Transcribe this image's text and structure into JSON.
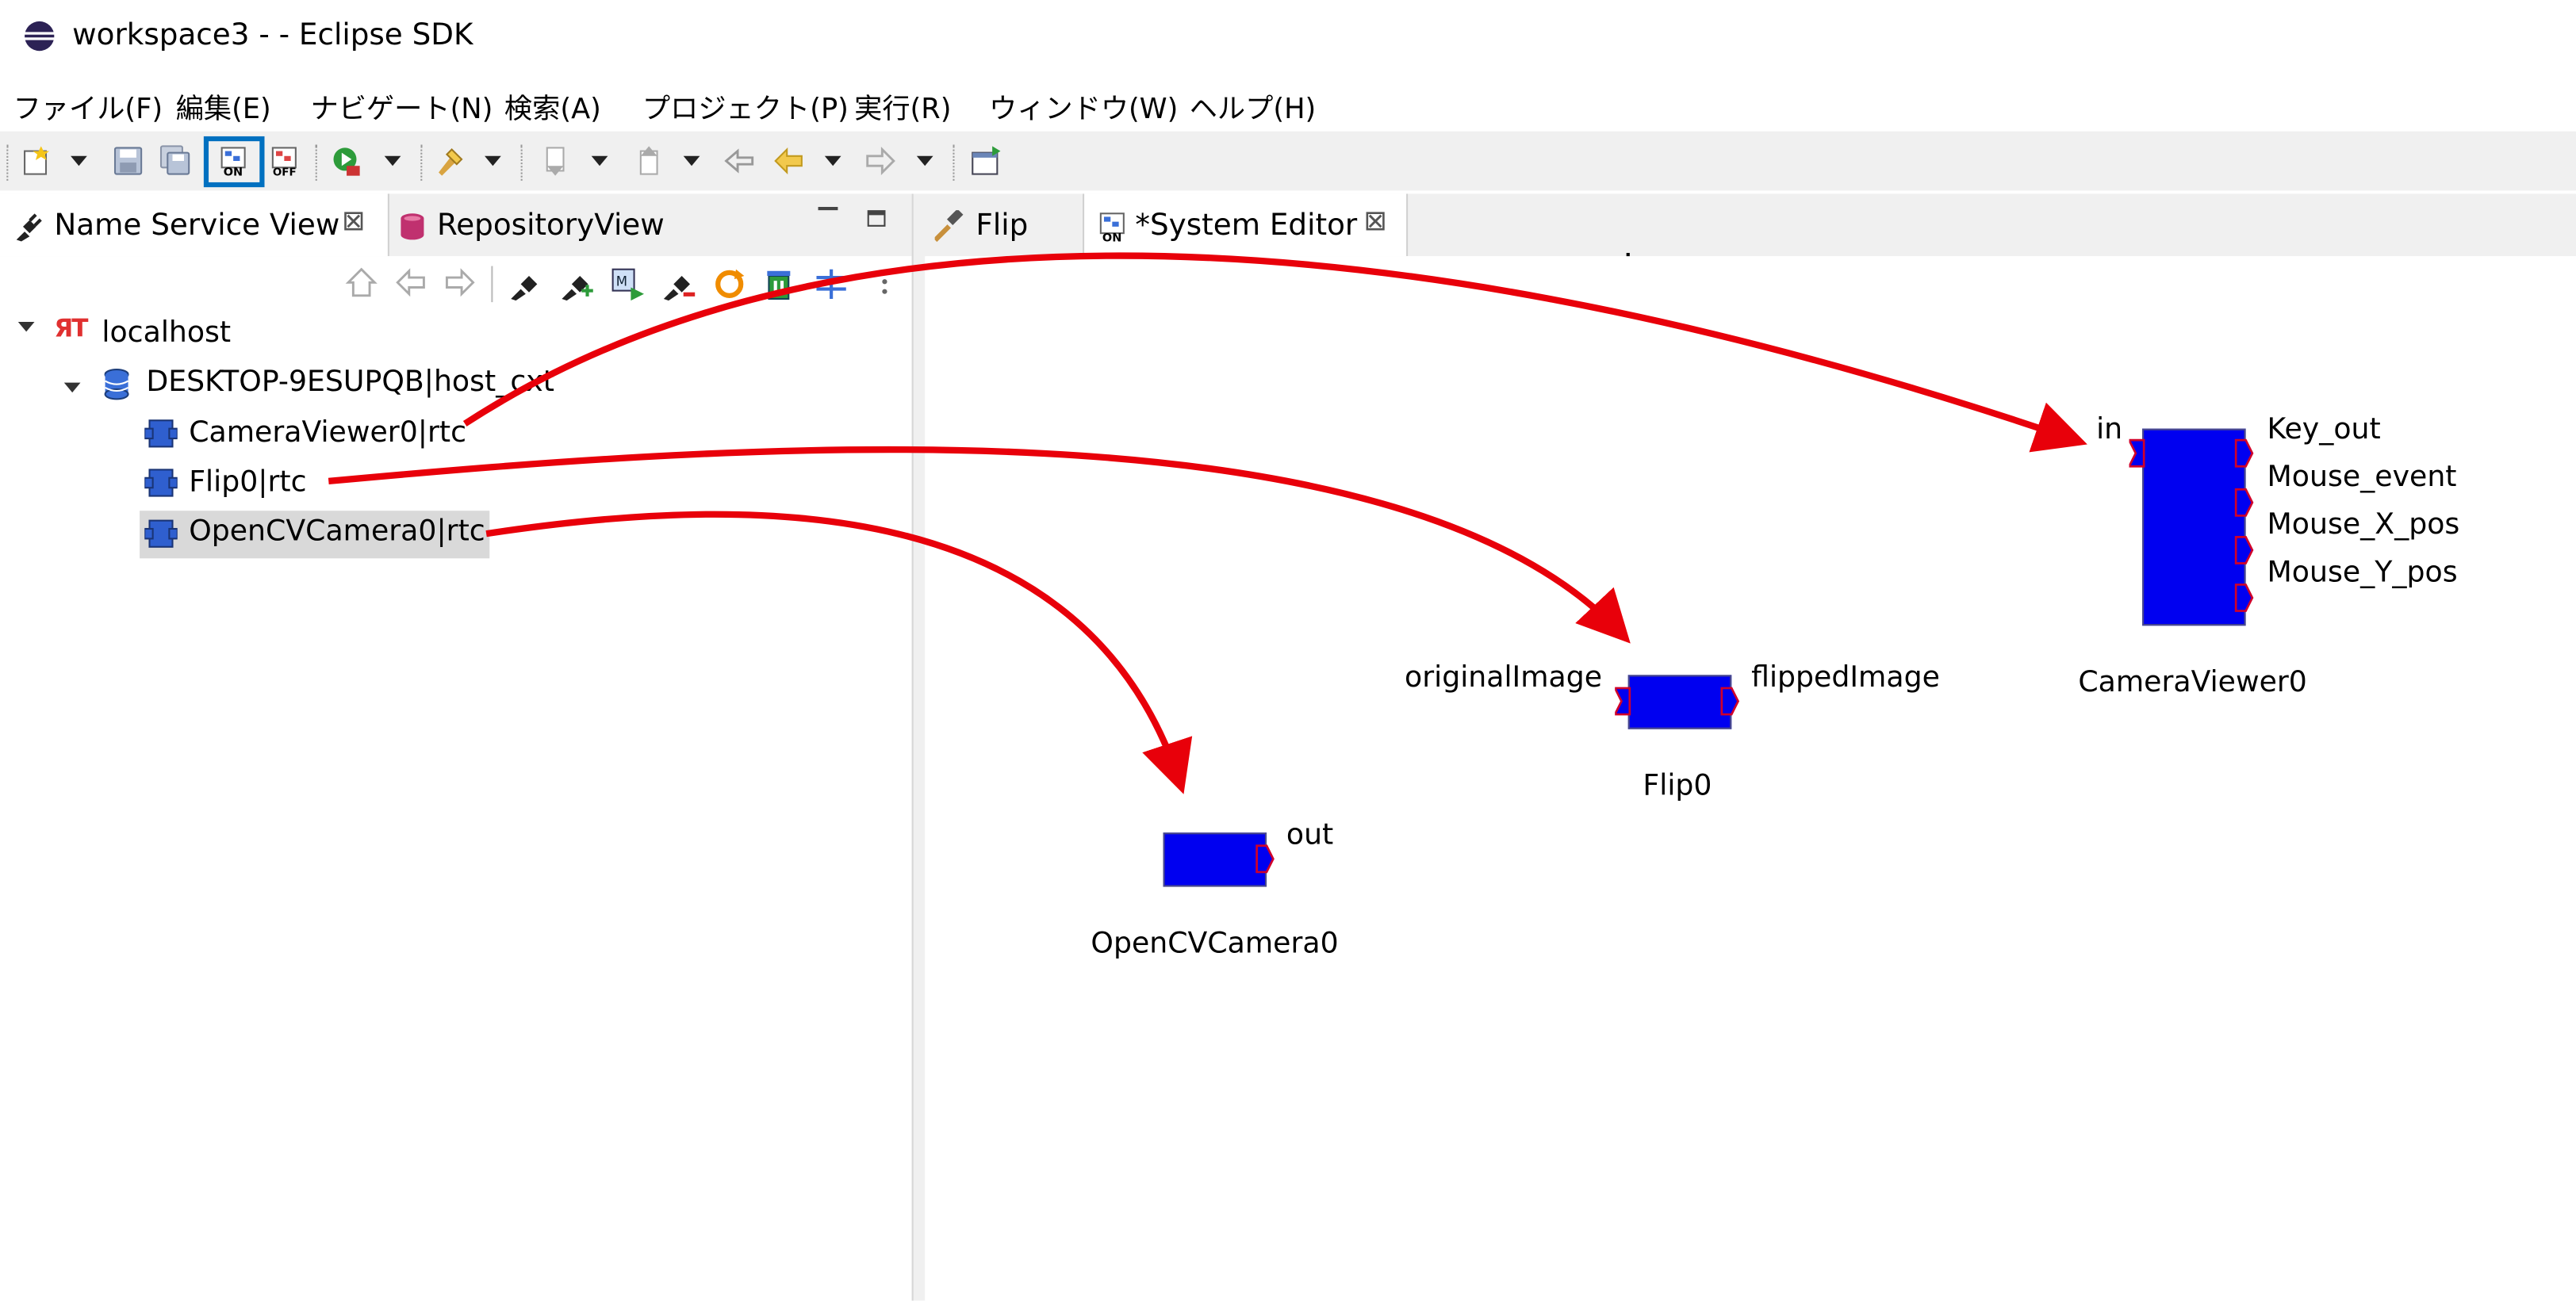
{
  "window": {
    "title": "workspace3 -  - Eclipse SDK"
  },
  "menu": [
    {
      "label": "ファイル(F)"
    },
    {
      "label": "編集(E)"
    },
    {
      "label": "ナビゲート(N)"
    },
    {
      "label": "検索(A)"
    },
    {
      "label": "プロジェクト(P)"
    },
    {
      "label": "実行(R)"
    },
    {
      "label": "ウィンドウ(W)"
    },
    {
      "label": "ヘルプ(H)"
    }
  ],
  "left_tabs": [
    {
      "label": "Name Service View",
      "active": true
    },
    {
      "label": "RepositoryView",
      "active": false
    }
  ],
  "editor_tabs": [
    {
      "label": "Flip",
      "active": false
    },
    {
      "label": "*System Editor",
      "active": true
    }
  ],
  "tree": {
    "host": "localhost",
    "context": "DESKTOP-9ESUPQB|host_cxt",
    "items": [
      {
        "label": "CameraViewer0|rtc",
        "selected": false
      },
      {
        "label": "Flip0|rtc",
        "selected": false
      },
      {
        "label": "OpenCVCamera0|rtc",
        "selected": true
      }
    ]
  },
  "components": {
    "camera_viewer": {
      "name": "CameraViewer0",
      "in_ports": [
        "in"
      ],
      "out_ports": [
        "Key_out",
        "Mouse_event",
        "Mouse_X_pos",
        "Mouse_Y_pos"
      ]
    },
    "flip": {
      "name": "Flip0",
      "in_ports": [
        "originalImage"
      ],
      "out_ports": [
        "flippedImage"
      ]
    },
    "camera": {
      "name": "OpenCVCamera0",
      "in_ports": [],
      "out_ports": [
        "out"
      ]
    }
  },
  "colors": {
    "component_fill": "#0000f0",
    "annotation_arrow": "#e8000a",
    "highlight_box": "#0070c0",
    "port_outline": "#d0002a",
    "selection": "#d9d9d9"
  },
  "icons": {
    "app": "eclipse-icon",
    "online": "online-editor-icon",
    "offline": "offline-editor-icon"
  }
}
